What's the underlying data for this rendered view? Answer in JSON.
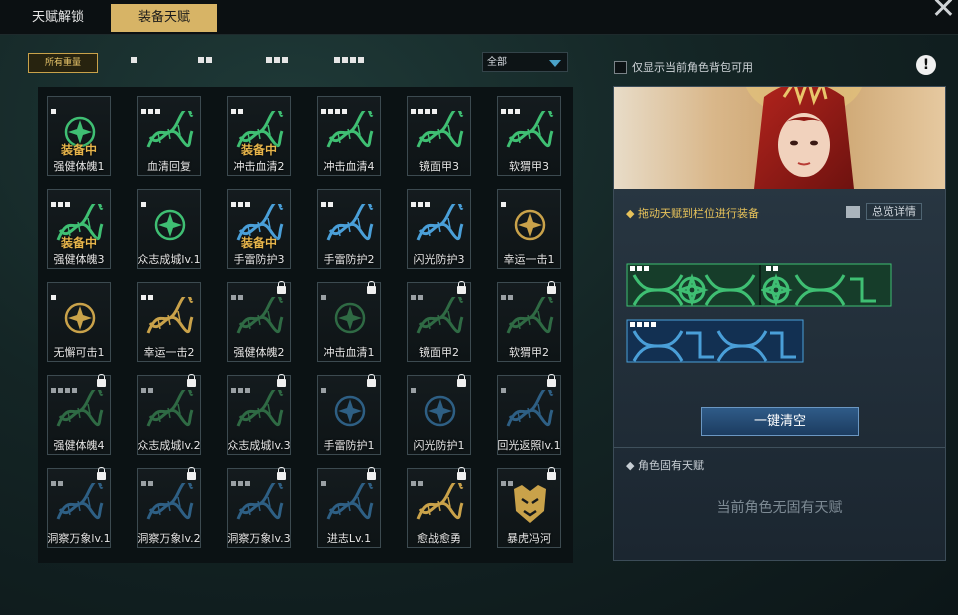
{
  "tabs": [
    "天赋解锁",
    "装备天赋"
  ],
  "filters": {
    "active": "所有重量",
    "levels": [
      1,
      2,
      3,
      4
    ],
    "dropdown": "全部"
  },
  "colors": {
    "green": "#3fbf73",
    "blue": "#4a9fd8",
    "gold": "#c9a24a",
    "dark": "#2b5a3c"
  },
  "cards": [
    {
      "label": "强健体魄1",
      "dots": 1,
      "icon": "star-emblem",
      "color": "green",
      "equipped": "装备中",
      "locked": false
    },
    {
      "label": "血清回复",
      "dots": 3,
      "icon": "dna",
      "color": "green",
      "locked": false
    },
    {
      "label": "冲击血清2",
      "dots": 2,
      "icon": "dna",
      "color": "green",
      "equipped": "装备中",
      "locked": false
    },
    {
      "label": "冲击血清4",
      "dots": 4,
      "icon": "dna",
      "color": "green",
      "locked": false
    },
    {
      "label": "镜面甲3",
      "dots": 4,
      "icon": "dna",
      "color": "green",
      "locked": false
    },
    {
      "label": "软猬甲3",
      "dots": 3,
      "icon": "dna",
      "color": "green",
      "locked": false
    },
    {
      "label": "强健体魄3",
      "dots": 3,
      "icon": "dna",
      "color": "green",
      "equipped": "装备中",
      "locked": false
    },
    {
      "label": "众志成城lv.1",
      "dots": 1,
      "icon": "star-emblem",
      "color": "green",
      "locked": false
    },
    {
      "label": "手雷防护3",
      "dots": 3,
      "icon": "dna",
      "color": "blue",
      "equipped": "装备中",
      "locked": false
    },
    {
      "label": "手雷防护2",
      "dots": 2,
      "icon": "dna",
      "color": "blue",
      "locked": false
    },
    {
      "label": "闪光防护3",
      "dots": 3,
      "icon": "dna",
      "color": "blue",
      "locked": false
    },
    {
      "label": "幸运一击1",
      "dots": 1,
      "icon": "star-emblem",
      "color": "gold",
      "locked": false
    },
    {
      "label": "无懈可击1",
      "dots": 1,
      "icon": "star-emblem",
      "color": "gold",
      "locked": false
    },
    {
      "label": "幸运一击2",
      "dots": 2,
      "icon": "dna",
      "color": "gold",
      "locked": false
    },
    {
      "label": "强健体魄2",
      "dots": 2,
      "icon": "dna",
      "color": "dark",
      "locked": true
    },
    {
      "label": "冲击血清1",
      "dots": 1,
      "icon": "star-emblem",
      "color": "dark",
      "locked": true
    },
    {
      "label": "镜面甲2",
      "dots": 2,
      "icon": "dna",
      "color": "dark",
      "locked": true
    },
    {
      "label": "软猬甲2",
      "dots": 2,
      "icon": "dna",
      "color": "dark",
      "locked": true
    },
    {
      "label": "强健体魄4",
      "dots": 4,
      "icon": "dna",
      "color": "dark",
      "locked": true
    },
    {
      "label": "众志成城lv.2",
      "dots": 2,
      "icon": "dna",
      "color": "dark",
      "locked": true
    },
    {
      "label": "众志成城lv.3",
      "dots": 3,
      "icon": "dna",
      "color": "dark",
      "locked": true
    },
    {
      "label": "手雷防护1",
      "dots": 1,
      "icon": "star-emblem",
      "color": "darkblue",
      "locked": true
    },
    {
      "label": "闪光防护1",
      "dots": 1,
      "icon": "star-emblem",
      "color": "darkblue",
      "locked": true
    },
    {
      "label": "回光返照lv.1",
      "dots": 1,
      "icon": "dna",
      "color": "darkblue",
      "locked": true
    },
    {
      "label": "洞察万象lv.1",
      "dots": 2,
      "icon": "dna",
      "color": "darkblue",
      "locked": true
    },
    {
      "label": "洞察万象lv.2",
      "dots": 2,
      "icon": "dna",
      "color": "darkblue",
      "locked": true
    },
    {
      "label": "洞察万象lv.3",
      "dots": 3,
      "icon": "dna",
      "color": "darkblue",
      "locked": true
    },
    {
      "label": "进志Lv.1",
      "dots": 1,
      "icon": "dna",
      "color": "darkblue",
      "locked": true
    },
    {
      "label": "愈战愈勇",
      "dots": 2,
      "icon": "dna",
      "color": "gold",
      "locked": true
    },
    {
      "label": "暴虎冯河",
      "dots": 2,
      "icon": "tiger-emblem",
      "color": "gold",
      "locked": true
    }
  ],
  "right_panel": {
    "checkbox_label": "仅显示当前角色背包可用",
    "drag_hint": "拖动天赋到栏位进行装备",
    "overview_label": "总览详情",
    "clear_button": "一键清空",
    "innate_title": "角色固有天赋",
    "innate_empty": "当前角色无固有天赋",
    "equipped_slots": [
      {
        "dots": 3,
        "color": "green"
      },
      {
        "dots": 2,
        "color": "green"
      },
      {
        "dots": 4,
        "color": "blue"
      }
    ]
  }
}
